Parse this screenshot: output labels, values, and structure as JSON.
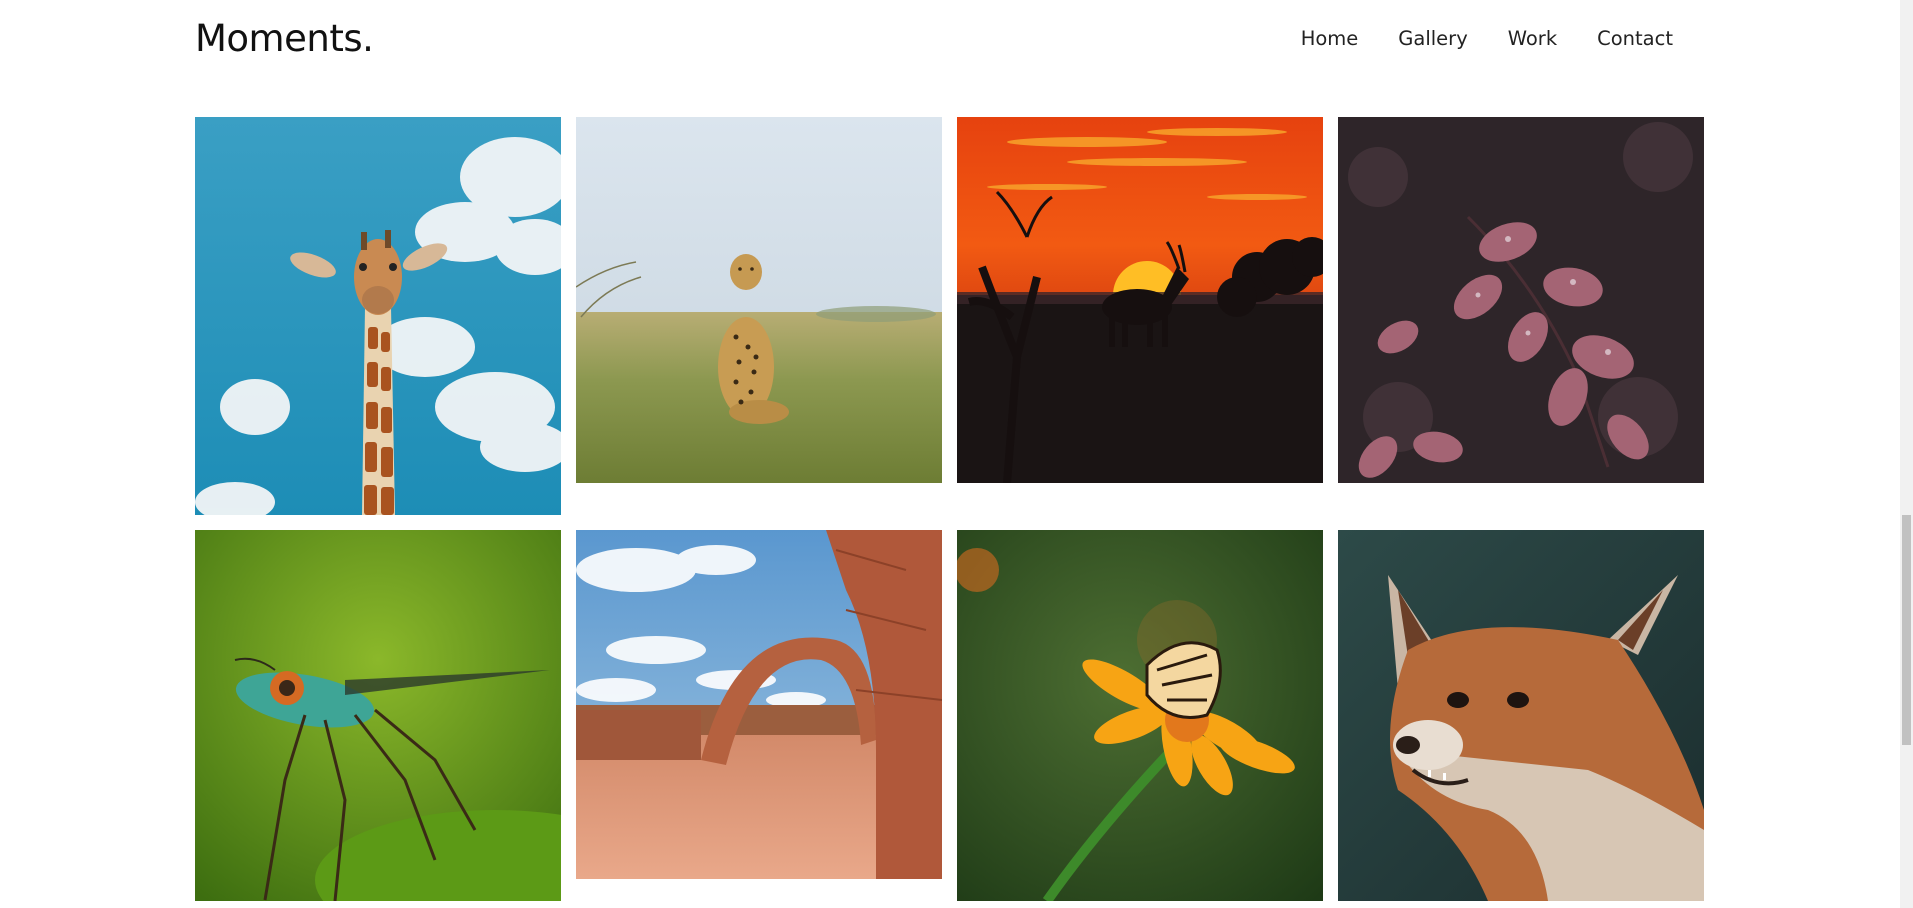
{
  "header": {
    "logo": "Moments.",
    "nav": [
      {
        "label": "Home"
      },
      {
        "label": "Gallery"
      },
      {
        "label": "Work"
      },
      {
        "label": "Contact"
      }
    ]
  },
  "gallery": {
    "images": [
      {
        "subject": "giraffe"
      },
      {
        "subject": "cheetah"
      },
      {
        "subject": "antelope-sunset"
      },
      {
        "subject": "leaves-with-droplets"
      },
      {
        "subject": "fly"
      },
      {
        "subject": "rock-arch"
      },
      {
        "subject": "butterfly-on-flower"
      },
      {
        "subject": "fox"
      }
    ]
  }
}
